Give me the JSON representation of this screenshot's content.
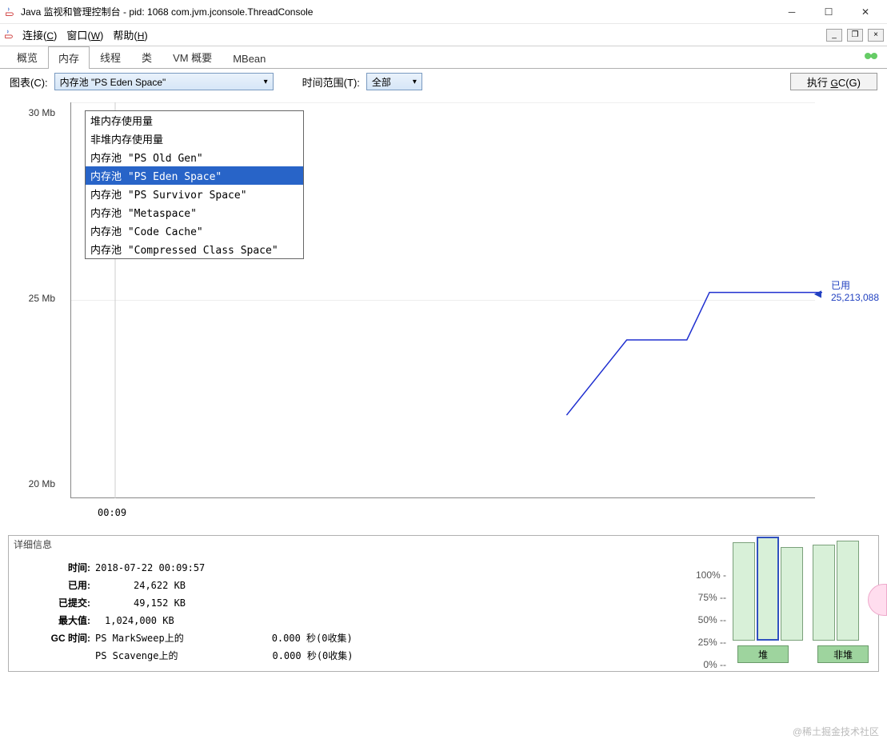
{
  "window": {
    "title": "Java 监视和管理控制台 - pid: 1068 com.jvm.jconsole.ThreadConsole"
  },
  "menu": {
    "connect": "连接(C)",
    "window": "窗口(W)",
    "help": "帮助(H)"
  },
  "tabs": [
    "概览",
    "内存",
    "线程",
    "类",
    "VM 概要",
    "MBean"
  ],
  "active_tab": 1,
  "toolbar": {
    "chart_label": "图表(C):",
    "chart_value": "内存池 \"PS Eden Space\"",
    "time_label": "时间范围(T):",
    "time_value": "全部",
    "gc_button": "执行 GC(G)"
  },
  "dropdown_options": [
    "堆内存使用量",
    "非堆内存使用量",
    "内存池 \"PS Old Gen\"",
    "内存池 \"PS Eden Space\"",
    "内存池 \"PS Survivor Space\"",
    "内存池 \"Metaspace\"",
    "内存池 \"Code Cache\"",
    "内存池 \"Compressed Class Space\""
  ],
  "dropdown_selected": 3,
  "chart_data": {
    "type": "line",
    "ylabel_unit": "Mb",
    "y_ticks": [
      20,
      25,
      30
    ],
    "x_ticks": [
      "00:09"
    ],
    "series": [
      {
        "name": "已用",
        "points": [
          [
            0.66,
            22.1
          ],
          [
            0.74,
            24.0
          ],
          [
            0.82,
            24.0
          ],
          [
            0.85,
            25.2
          ],
          [
            1.0,
            25.2
          ]
        ]
      }
    ],
    "ylim": [
      20,
      30
    ],
    "current_label": "已用",
    "current_value": "25,213,088"
  },
  "details": {
    "title": "详细信息",
    "rows": {
      "time_label": "时间:",
      "time": "2018-07-22 00:09:57",
      "used_label": "已用:",
      "used": "24,622 KB",
      "committed_label": "已提交:",
      "committed": "49,152 KB",
      "max_label": "最大值:",
      "max": "1,024,000 KB",
      "gc_label": "GC 时间:",
      "gc1_name": "PS MarkSweep上的",
      "gc1_val": "0.000 秒(0收集)",
      "gc2_name": "PS Scavenge上的",
      "gc2_val": "0.000 秒(0收集)"
    },
    "bar_ticks": [
      "100% --",
      "75% --",
      "50% --",
      "25% --",
      "0% --"
    ],
    "heap_button": "堆",
    "nonheap_button": "非堆",
    "heap_bars": [
      95,
      100,
      90
    ],
    "nonheap_bars": [
      92,
      96
    ]
  },
  "watermark": "@稀土掘金技术社区"
}
